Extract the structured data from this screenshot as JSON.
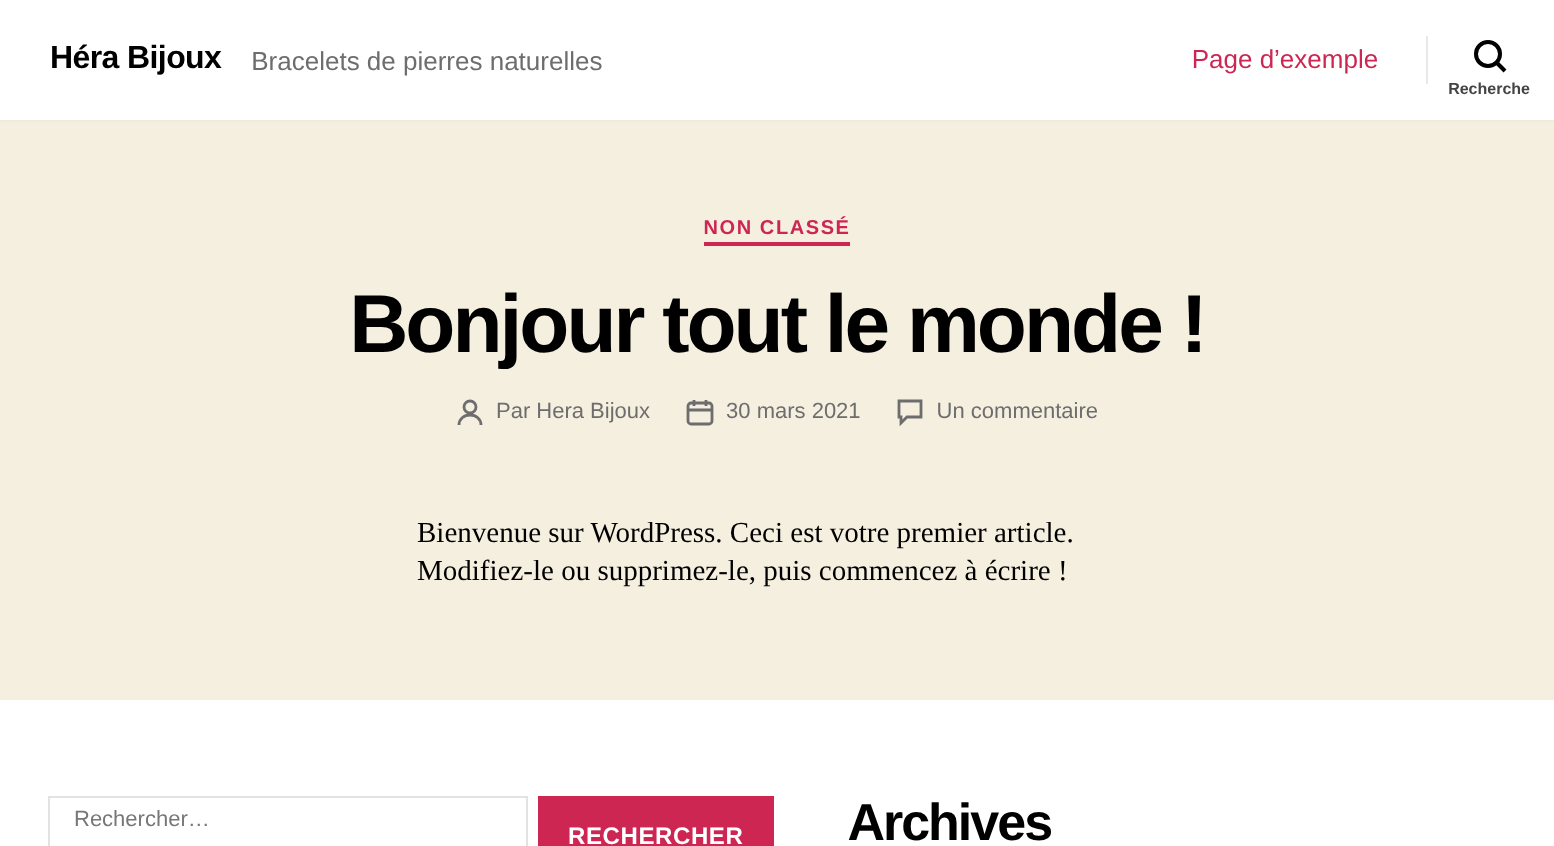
{
  "header": {
    "site_title": "Héra Bijoux",
    "tagline": "Bracelets de pierres naturelles",
    "menu": [
      {
        "label": "Page d’exemple"
      }
    ],
    "search_toggle": {
      "label": "Recherche"
    }
  },
  "post": {
    "category": "NON CLASSÉ",
    "title": "Bonjour tout le monde !",
    "meta": [
      {
        "kind": "author",
        "text": "Par Hera Bijoux"
      },
      {
        "kind": "date",
        "text": "30 mars 2021"
      },
      {
        "kind": "comments",
        "text": "Un commentaire"
      }
    ],
    "content": "Bienvenue sur WordPress. Ceci est votre premier article. Modifiez-le ou supprimez-le, puis commencez à écrire !"
  },
  "footer": {
    "search": {
      "placeholder": "Rechercher…",
      "button": "RECHERCHER"
    },
    "widget_title": "Archives"
  }
}
